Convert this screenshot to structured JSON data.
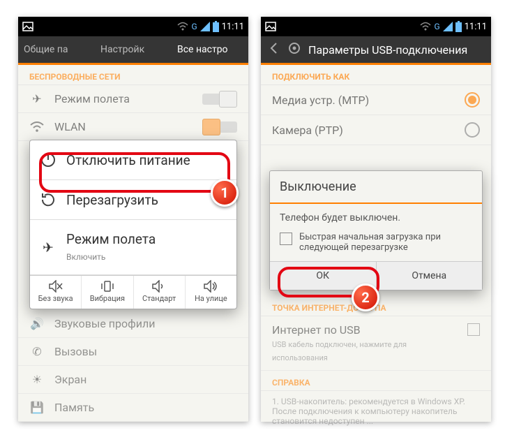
{
  "statusbar": {
    "network_label": "G",
    "time": "11:11"
  },
  "left": {
    "tabs": [
      {
        "label": "Общие па"
      },
      {
        "label": "Настройк"
      },
      {
        "label": "Все настро"
      }
    ],
    "sections": {
      "wireless_header": "БЕСПРОВОДНЫЕ СЕТИ",
      "airplane": "Режим полета",
      "wlan": "WLAN",
      "sound_profiles": "Звуковые профили",
      "calls": "Вызовы",
      "display": "Экран",
      "storage": "Память"
    },
    "powermenu": {
      "power_off": "Отключить питание",
      "reboot": "Перезагрузить",
      "airplane": "Режим полета",
      "airplane_sub": "Включить",
      "profiles": [
        {
          "label": "Без звука"
        },
        {
          "label": "Вибрация"
        },
        {
          "label": "Стандарт"
        },
        {
          "label": "На улице"
        }
      ]
    }
  },
  "right": {
    "header": "Параметры USB-подключения",
    "connect_as_header": "ПОДКЛЮЧИТЬ КАК",
    "mtp": "Медиа устр. (MTP)",
    "ptp": "Камера (PTP)",
    "hotspot_header": "ТОЧКА ИНТЕРНЕТ-ДОСТУПА",
    "usb_internet": "Интернет по USB",
    "usb_internet_sub": "USB кабель подключен, нажмите для использования",
    "help_header": "СПРАВКА",
    "help_text": "1. USB-накопитель: рекомендуется в Windows XP. После подключения к компьютеру накопитель становится недоступен ...",
    "dialog": {
      "title": "Выключение",
      "body": "Телефон будет выключен.",
      "fast_boot": "Быстрая начальная загрузка при следующей перезагрузке",
      "ok": "ОК",
      "cancel": "Отмена"
    }
  }
}
